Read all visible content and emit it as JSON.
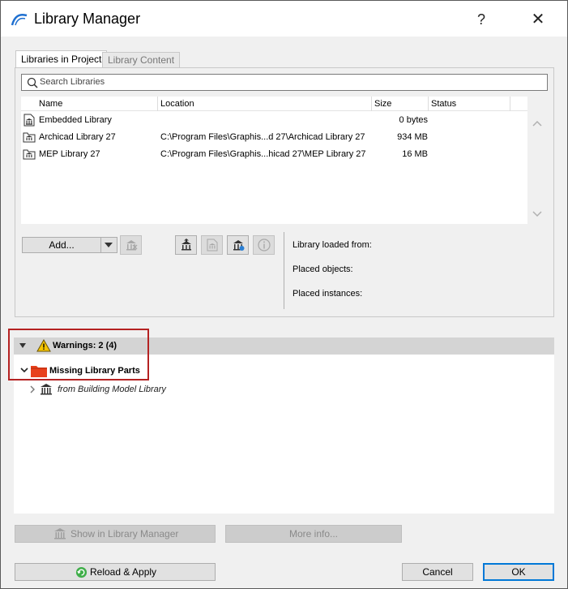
{
  "window": {
    "title": "Library Manager",
    "help_label": "?",
    "close_label": "✕"
  },
  "tabs": [
    {
      "label": "Libraries in Project",
      "active": true
    },
    {
      "label": "Library Content",
      "active": false
    }
  ],
  "search": {
    "placeholder": "Search Libraries"
  },
  "table": {
    "columns": [
      "Name",
      "Location",
      "Size",
      "Status"
    ],
    "rows": [
      {
        "name": "Embedded Library",
        "location": "",
        "size": "0 bytes",
        "status": ""
      },
      {
        "name": "Archicad Library 27",
        "location": "C:\\Program Files\\Graphis...d 27\\Archicad Library 27",
        "size": "934 MB",
        "status": ""
      },
      {
        "name": "MEP Library 27",
        "location": "C:\\Program Files\\Graphis...hicad 27\\MEP Library 27",
        "size": "16 MB",
        "status": ""
      }
    ]
  },
  "toolbar": {
    "add_label": "Add..."
  },
  "info": {
    "loaded_from": "Library loaded from:",
    "placed_objects": "Placed objects:",
    "placed_instances": "Placed instances:"
  },
  "warnings": {
    "label": "Warnings: 2 (4)",
    "group_label": "Missing Library Parts",
    "item_label": "from Building Model Library"
  },
  "buttons": {
    "show_in_manager": "Show in Library Manager",
    "more_info": "More info...",
    "reload_apply": "Reload & Apply",
    "cancel": "Cancel",
    "ok": "OK"
  },
  "colors": {
    "highlight": "#b52222",
    "ok_border": "#0078d7",
    "folder": "#e8401c",
    "warning": "#f5c400"
  }
}
